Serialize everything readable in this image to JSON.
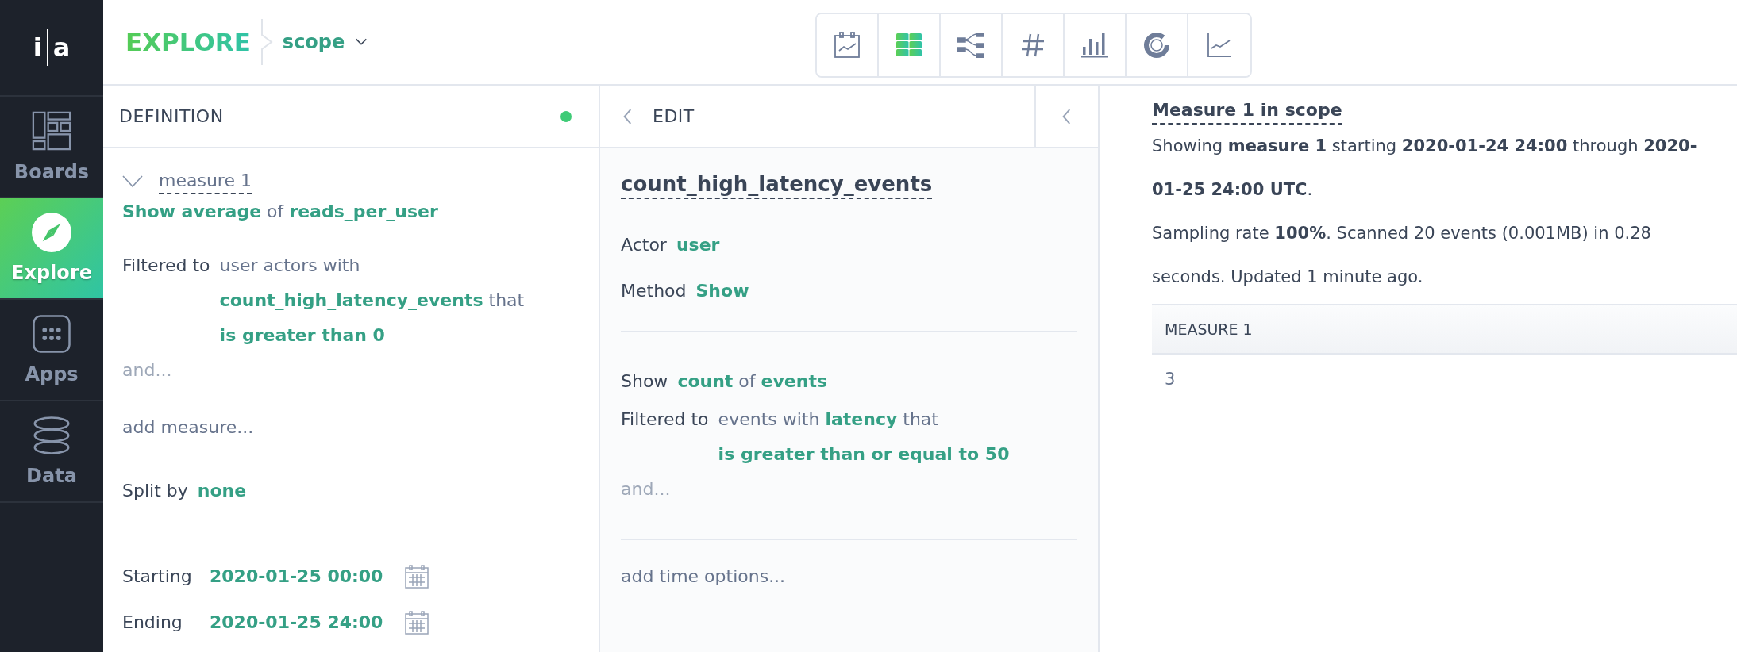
{
  "sidebar": {
    "logo_letters": [
      "i",
      "a"
    ],
    "items": [
      {
        "label": "Boards",
        "kind": "boards",
        "selected": false
      },
      {
        "label": "Explore",
        "kind": "explore",
        "selected": true
      },
      {
        "label": "Apps",
        "kind": "apps",
        "selected": false
      },
      {
        "label": "Data",
        "kind": "data",
        "selected": false
      }
    ]
  },
  "header": {
    "title": "EXPLORE",
    "breadcrumb": "scope"
  },
  "toolbar": [
    {
      "kind": "calendar-chart",
      "selected": false
    },
    {
      "kind": "table",
      "selected": true
    },
    {
      "kind": "flow",
      "selected": false
    },
    {
      "kind": "number",
      "selected": false
    },
    {
      "kind": "bar",
      "selected": false
    },
    {
      "kind": "donut",
      "selected": false
    },
    {
      "kind": "line",
      "selected": false
    }
  ],
  "definition": {
    "title": "DEFINITION",
    "status_dot": true,
    "measure": {
      "name": "measure 1",
      "expanded": true,
      "summary": "**Show average** of **reads_per_user**",
      "filter": {
        "label": "Filtered to",
        "lines": [
          "user actors with",
          "**count_high_latency_events** that",
          "**is greater than 0**"
        ]
      },
      "and_hint": "and..."
    },
    "add_measure": "add measure...",
    "split": {
      "label": "Split by",
      "value": "none"
    },
    "time": [
      {
        "label": "Starting",
        "value": "2020-01-25 00:00"
      },
      {
        "label": "Ending",
        "value": "2020-01-25 24:00"
      }
    ]
  },
  "edit": {
    "title": "EDIT",
    "metric": "count_high_latency_events",
    "fields": [
      {
        "label": "Actor",
        "value": "user"
      },
      {
        "label": "Method",
        "value": "Show"
      }
    ],
    "show": {
      "label": "Show",
      "text": "**count** of **events**"
    },
    "filter": {
      "label": "Filtered to",
      "lines": [
        "events with **latency** that",
        "**is greater than or equal to 50**"
      ]
    },
    "and_hint": "and...",
    "add_time": "add time options..."
  },
  "results": {
    "title": "Measure 1 in scope",
    "paragraphs": [
      "Showing **measure 1** starting **2020-01-24 24:00** through **2020-01-25 24:00 UTC**.",
      "Sampling rate **100%**. Scanned 20 events (0.001MB) in 0.28 seconds. Updated 1 minute ago."
    ],
    "table": {
      "columns": [
        "MEASURE 1"
      ],
      "rows": [
        [
          "3"
        ]
      ]
    }
  }
}
